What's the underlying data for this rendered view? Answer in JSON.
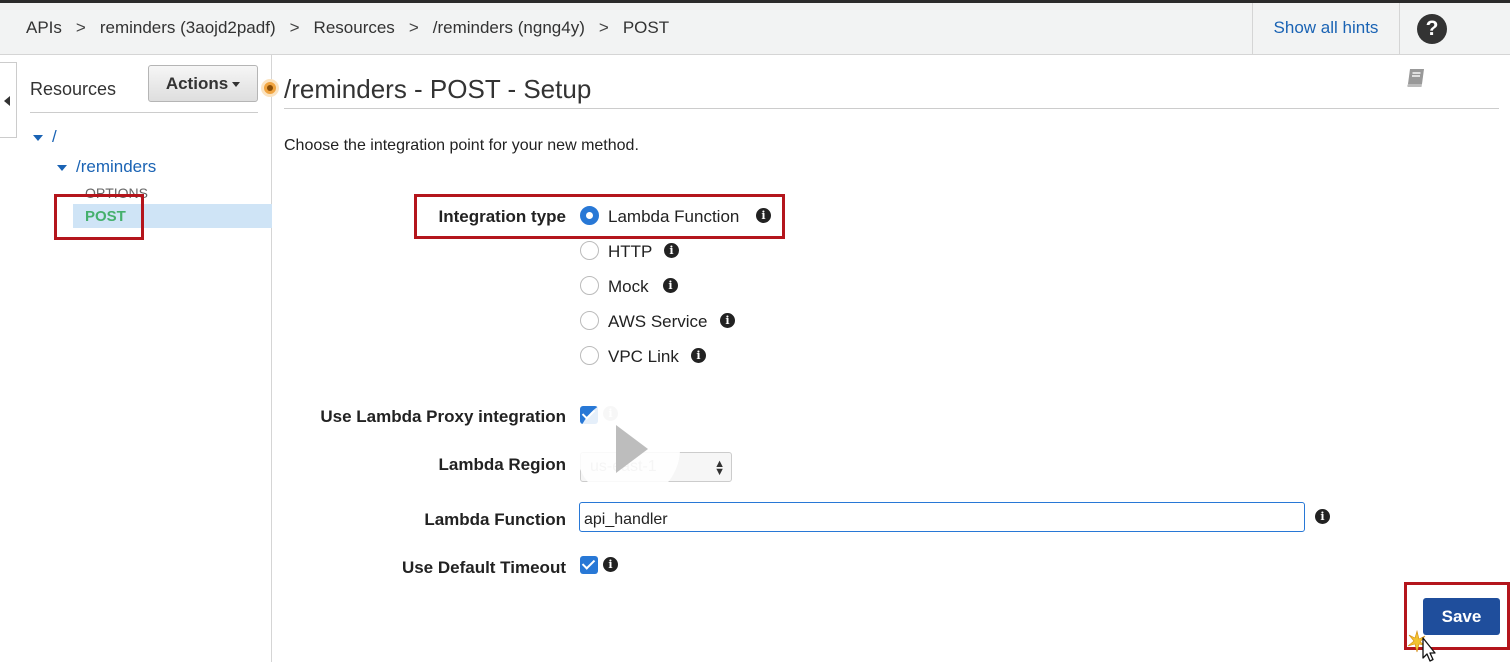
{
  "breadcrumb": {
    "items": [
      "APIs",
      "reminders (3aojd2padf)",
      "Resources",
      "/reminders (ngng4y)",
      "POST"
    ],
    "separator": ">"
  },
  "header": {
    "hints_label": "Show all hints",
    "help_icon": "question-circle-icon",
    "help_glyph": "?"
  },
  "sidebar": {
    "title": "Resources",
    "actions_label": "Actions",
    "tree": {
      "root": "/",
      "resource": "/reminders",
      "methods": [
        "OPTIONS",
        "POST"
      ]
    }
  },
  "main": {
    "title": "/reminders - POST - Setup",
    "intro": "Choose the integration point for your new method.",
    "integration_type_label": "Integration type",
    "integration_options": [
      "Lambda Function",
      "HTTP",
      "Mock",
      "AWS Service",
      "VPC Link"
    ],
    "selected_integration": "Lambda Function",
    "proxy_label": "Use Lambda Proxy integration",
    "proxy_checked": true,
    "region_label": "Lambda Region",
    "region_value": "us-east-1",
    "function_label": "Lambda Function",
    "function_value": "api_handler",
    "timeout_label": "Use Default Timeout",
    "timeout_checked": true,
    "info_glyph": "i",
    "save_label": "Save"
  },
  "colors": {
    "accent": "#2878d6",
    "link": "#1a63b4",
    "save_button": "#1f4e9c",
    "highlight": "#b4151c",
    "method_post": "#45b06c"
  }
}
